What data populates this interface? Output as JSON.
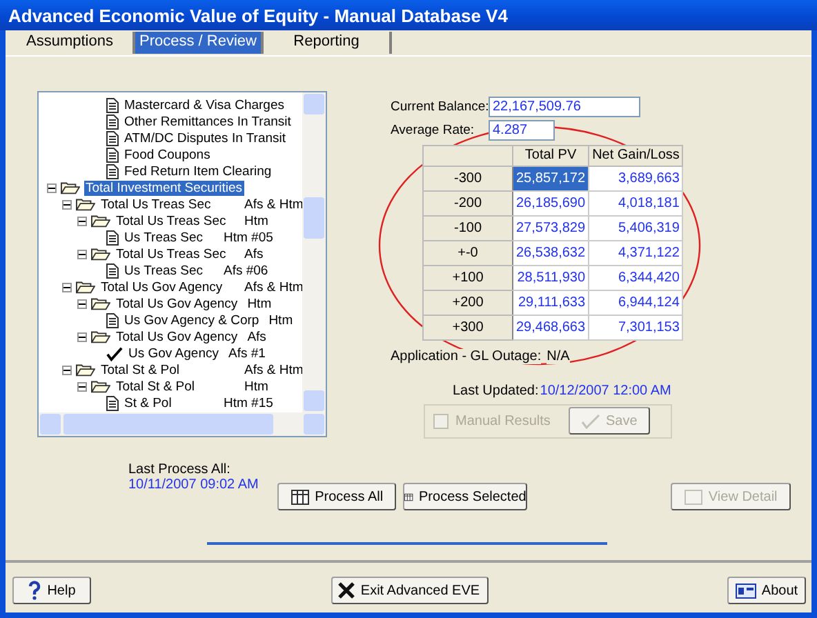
{
  "window": {
    "title": "Advanced Economic Value of Equity - Manual Database V4"
  },
  "tabs": [
    {
      "label": "Assumptions",
      "selected": false
    },
    {
      "label": "Process / Review",
      "selected": true
    },
    {
      "label": "Reporting",
      "selected": false
    }
  ],
  "tree": {
    "continued_items": [
      {
        "kind": "doc",
        "label": "Mastercard & Visa Charges",
        "selected": false
      },
      {
        "kind": "doc",
        "label": "Other Remittances In Transit",
        "selected": false
      },
      {
        "kind": "doc",
        "label": "ATM/DC Disputes In Transit",
        "selected": false
      },
      {
        "kind": "doc",
        "label": "Food Coupons",
        "selected": false
      },
      {
        "kind": "doc",
        "label": "Fed Return Item Clearing",
        "selected": false
      }
    ],
    "items": [
      {
        "kind": "folder",
        "label": "Total Investment Securities",
        "selected": true,
        "expanded": true,
        "children": [
          {
            "kind": "folder",
            "label": "Total Us Treas Sec",
            "tag": "Afs & Htm",
            "selected": false,
            "expanded": true,
            "children": [
              {
                "kind": "folder",
                "label": "Total Us Treas Sec",
                "tag": "Htm",
                "selected": false,
                "expanded": true,
                "children": [
                  {
                    "kind": "doc",
                    "label": "Us Treas Sec",
                    "tag": "Htm #05",
                    "selected": false
                  }
                ]
              },
              {
                "kind": "folder",
                "label": "Total Us Treas Sec",
                "tag": "Afs",
                "selected": false,
                "expanded": true,
                "children": [
                  {
                    "kind": "doc",
                    "label": "Us Treas Sec",
                    "tag": "Afs #06",
                    "selected": false
                  }
                ]
              }
            ]
          },
          {
            "kind": "folder",
            "label": "Total Us Gov Agency",
            "tag": "Afs & Htm",
            "selected": false,
            "expanded": true,
            "children": [
              {
                "kind": "folder",
                "label": "Total Us Gov Agency",
                "tag": "Htm",
                "selected": false,
                "expanded": true,
                "children": [
                  {
                    "kind": "doc",
                    "label": "Us Gov Agency & Corp",
                    "tag": "Htm",
                    "selected": false
                  }
                ]
              },
              {
                "kind": "folder",
                "label": "Total Us Gov Agency",
                "tag": "Afs",
                "selected": false,
                "expanded": true,
                "children": [
                  {
                    "kind": "check",
                    "label": "Us Gov Agency",
                    "tag": "Afs #1",
                    "selected": false
                  }
                ]
              }
            ]
          },
          {
            "kind": "folder",
            "label": "Total St & Pol",
            "tag": "Afs & Htm",
            "selected": false,
            "expanded": true,
            "children": [
              {
                "kind": "folder",
                "label": "Total St & Pol",
                "tag": "Htm",
                "selected": false,
                "expanded": true,
                "children": [
                  {
                    "kind": "doc",
                    "label": "St & Pol",
                    "tag": "Htm #15",
                    "selected": false
                  }
                ]
              }
            ]
          }
        ]
      }
    ]
  },
  "current_balance": {
    "label": "Current Balance:",
    "value": "22,167,509.76"
  },
  "average_rate": {
    "label": "Average Rate:",
    "value": "4.287"
  },
  "table": {
    "columns": [
      "Total PV",
      "Net Gain/Loss"
    ],
    "rows": [
      {
        "shift": "-300",
        "total_pv": "25,857,172",
        "net_gain_loss": "3,689,663",
        "selected": true
      },
      {
        "shift": "-200",
        "total_pv": "26,185,690",
        "net_gain_loss": "4,018,181",
        "selected": false
      },
      {
        "shift": "-100",
        "total_pv": "27,573,829",
        "net_gain_loss": "5,406,319",
        "selected": false
      },
      {
        "shift": "+-0",
        "total_pv": "26,538,632",
        "net_gain_loss": "4,371,122",
        "selected": false
      },
      {
        "shift": "+100",
        "total_pv": "28,511,930",
        "net_gain_loss": "6,344,420",
        "selected": false
      },
      {
        "shift": "+200",
        "total_pv": "29,111,633",
        "net_gain_loss": "6,944,124",
        "selected": false
      },
      {
        "shift": "+300",
        "total_pv": "29,468,663",
        "net_gain_loss": "7,301,153",
        "selected": false
      }
    ]
  },
  "outage": {
    "label": "Application - GL Outage:",
    "value": "N/A"
  },
  "last_updated": {
    "label": "Last Updated:",
    "value": "10/12/2007 12:00 AM"
  },
  "manual_results": {
    "label": "Manual Results",
    "checked": false,
    "disabled": true
  },
  "save_button": {
    "label": "Save",
    "disabled": true
  },
  "last_process": {
    "label": "Last Process All:",
    "value": "10/11/2007 09:02 AM"
  },
  "process_buttons": [
    {
      "label": "Process All",
      "disabled": false
    },
    {
      "label": "Process Selected",
      "disabled": false
    }
  ],
  "view_detail_button": {
    "label": "View Detail",
    "disabled": true
  },
  "footer_buttons": [
    {
      "kind": "help",
      "label": "Help"
    },
    {
      "kind": "exit",
      "label": "Exit Advanced EVE"
    },
    {
      "kind": "about",
      "label": "About"
    }
  ]
}
